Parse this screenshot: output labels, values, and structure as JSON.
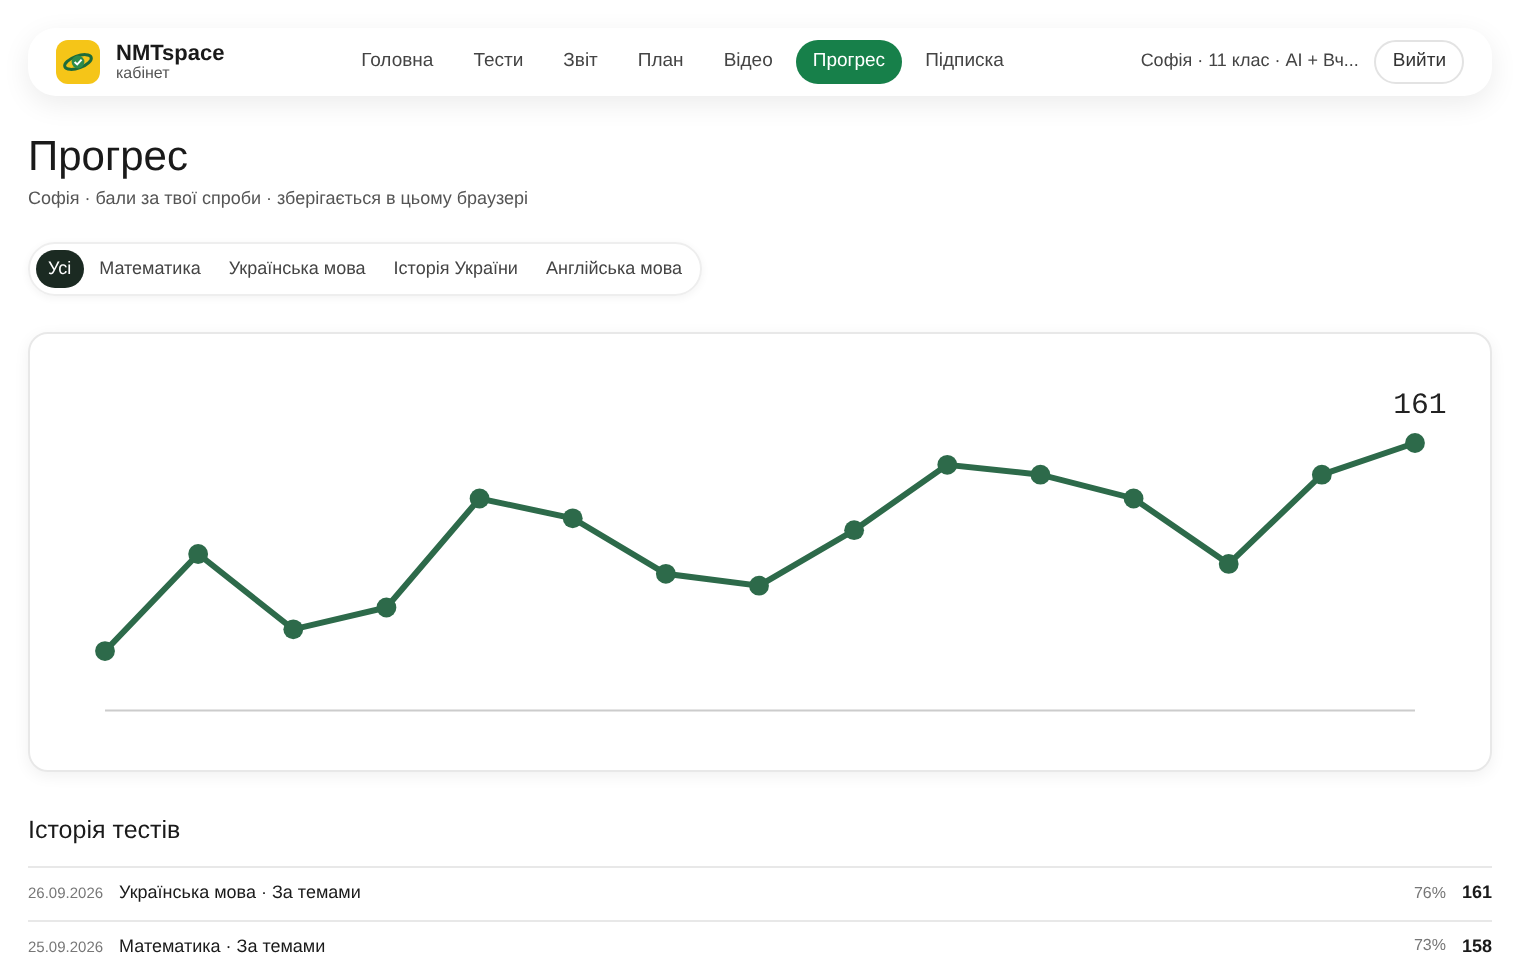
{
  "brand": {
    "name": "NMTspace",
    "subtitle": "кабінет"
  },
  "nav": [
    {
      "label": "Головна",
      "selected": false
    },
    {
      "label": "Тести",
      "selected": false
    },
    {
      "label": "Звіт",
      "selected": false
    },
    {
      "label": "План",
      "selected": false
    },
    {
      "label": "Відео",
      "selected": false
    },
    {
      "label": "Прогрес",
      "selected": true
    },
    {
      "label": "Підписка",
      "selected": false
    }
  ],
  "user": "Софія · 11 клас · AI + Вч...",
  "logout": "Вийти",
  "title": "Прогрес",
  "subtitle": "Софія · бали за твої спроби · зберігається в цьому браузері",
  "filters": [
    {
      "label": "Усі",
      "selected": true
    },
    {
      "label": "Математика",
      "selected": false
    },
    {
      "label": "Українська мова",
      "selected": false
    },
    {
      "label": "Історія України",
      "selected": false
    },
    {
      "label": "Англійська мова",
      "selected": false
    }
  ],
  "chart": {
    "last_value": "161"
  },
  "history": {
    "title": "Історія тестів",
    "rows": [
      {
        "date": "26.09.2026",
        "name": "Українська мова · За темами",
        "percent": "76%",
        "score": "161"
      },
      {
        "date": "25.09.2026",
        "name": "Математика · За темами",
        "percent": "73%",
        "score": "158"
      }
    ]
  }
}
